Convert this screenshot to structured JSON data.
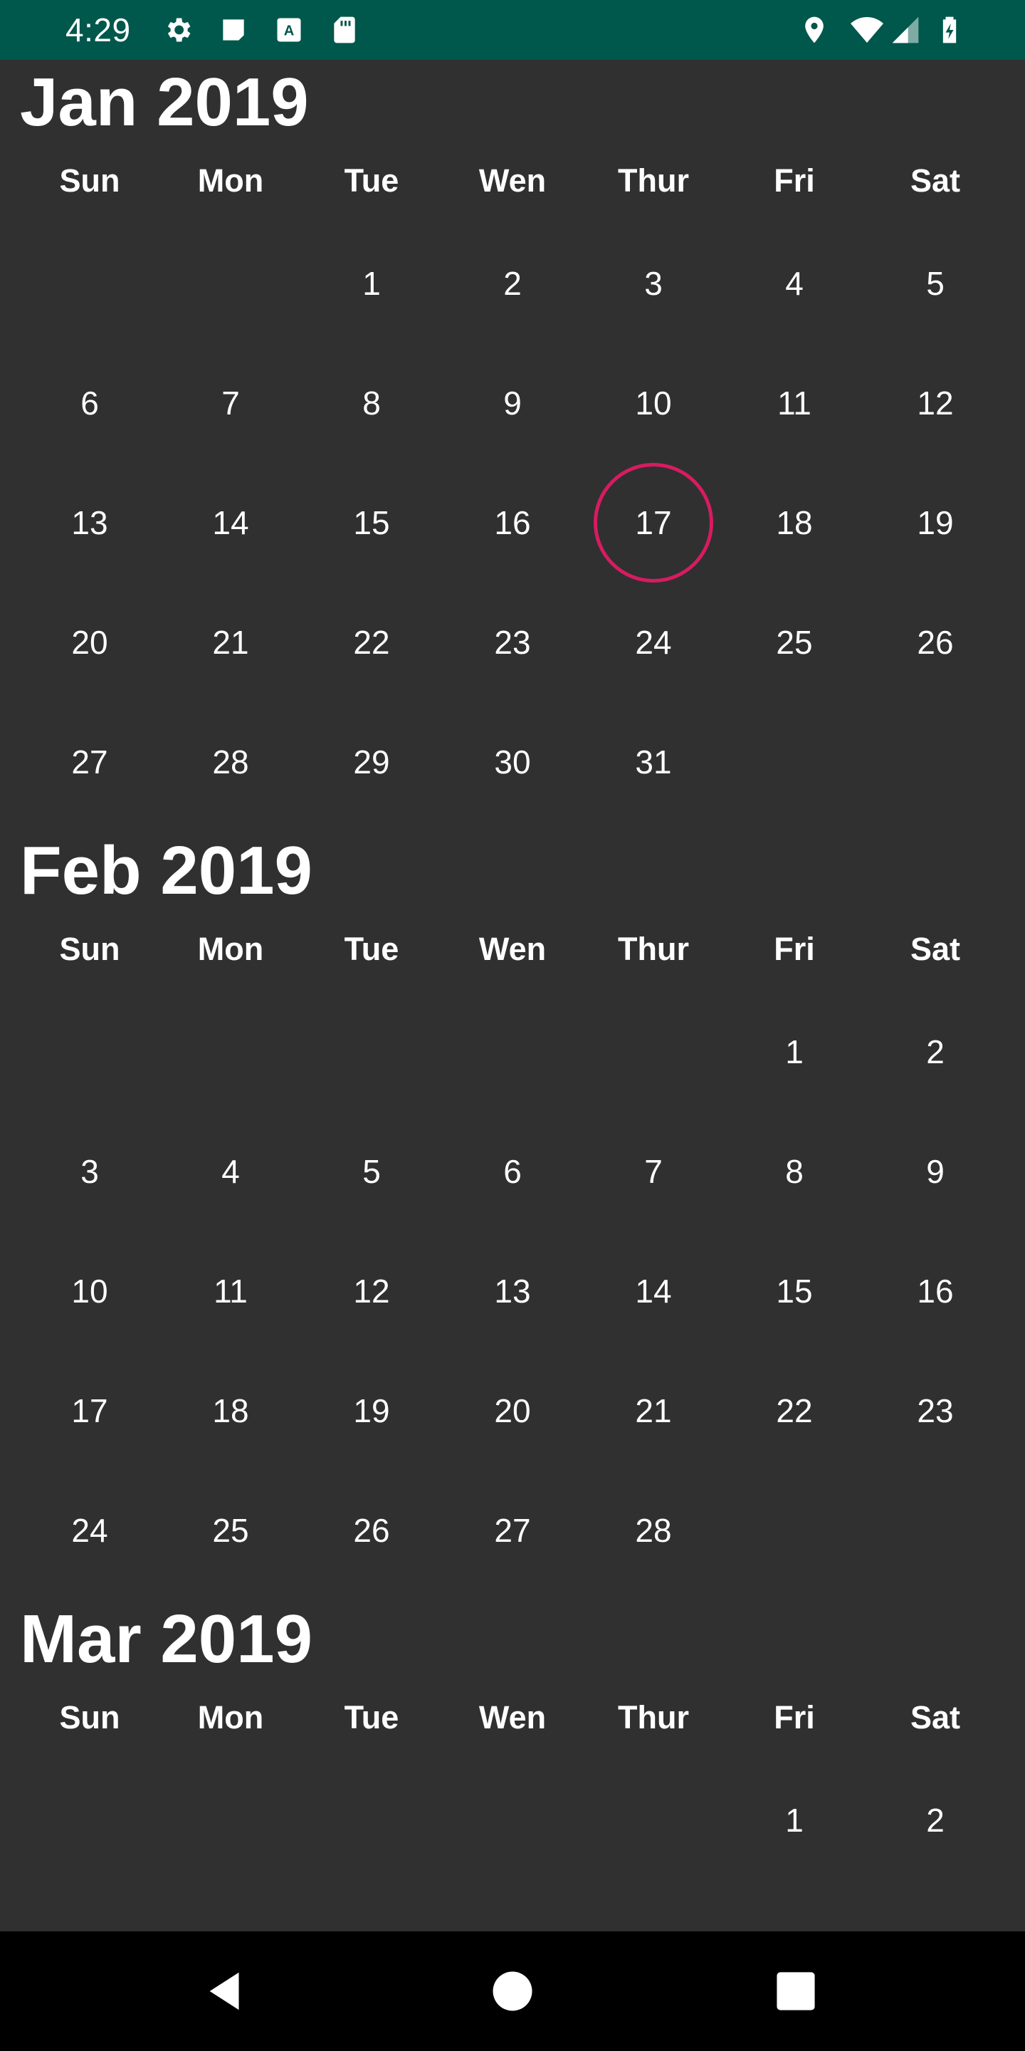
{
  "status_bar": {
    "time": "4:29",
    "left_icons": [
      "gear-icon",
      "notification-icon",
      "keyboard-a-icon",
      "sd-card-icon"
    ],
    "right_icons": [
      "location-icon",
      "wifi-icon",
      "signal-icon",
      "battery-charging-icon"
    ],
    "background_color": "#00574b"
  },
  "weekday_labels": [
    "Sun",
    "Mon",
    "Tue",
    "Wen",
    "Thur",
    "Fri",
    "Sat"
  ],
  "today_highlight_color": "#d81b60",
  "months": [
    {
      "title": "Jan 2019",
      "first_weekday_index": 2,
      "days": [
        "1",
        "2",
        "3",
        "4",
        "5",
        "6",
        "7",
        "8",
        "9",
        "10",
        "11",
        "12",
        "13",
        "14",
        "15",
        "16",
        "17",
        "18",
        "19",
        "20",
        "21",
        "22",
        "23",
        "24",
        "25",
        "26",
        "27",
        "28",
        "29",
        "30",
        "31"
      ],
      "today": "17"
    },
    {
      "title": "Feb 2019",
      "first_weekday_index": 5,
      "days": [
        "1",
        "2",
        "3",
        "4",
        "5",
        "6",
        "7",
        "8",
        "9",
        "10",
        "11",
        "12",
        "13",
        "14",
        "15",
        "16",
        "17",
        "18",
        "19",
        "20",
        "21",
        "22",
        "23",
        "24",
        "25",
        "26",
        "27",
        "28"
      ],
      "today": null
    },
    {
      "title": "Mar 2019",
      "first_weekday_index": 5,
      "days": [
        "1",
        "2"
      ],
      "today": null
    }
  ],
  "nav_bar": {
    "buttons": [
      "back-icon",
      "home-icon",
      "recents-icon"
    ]
  }
}
